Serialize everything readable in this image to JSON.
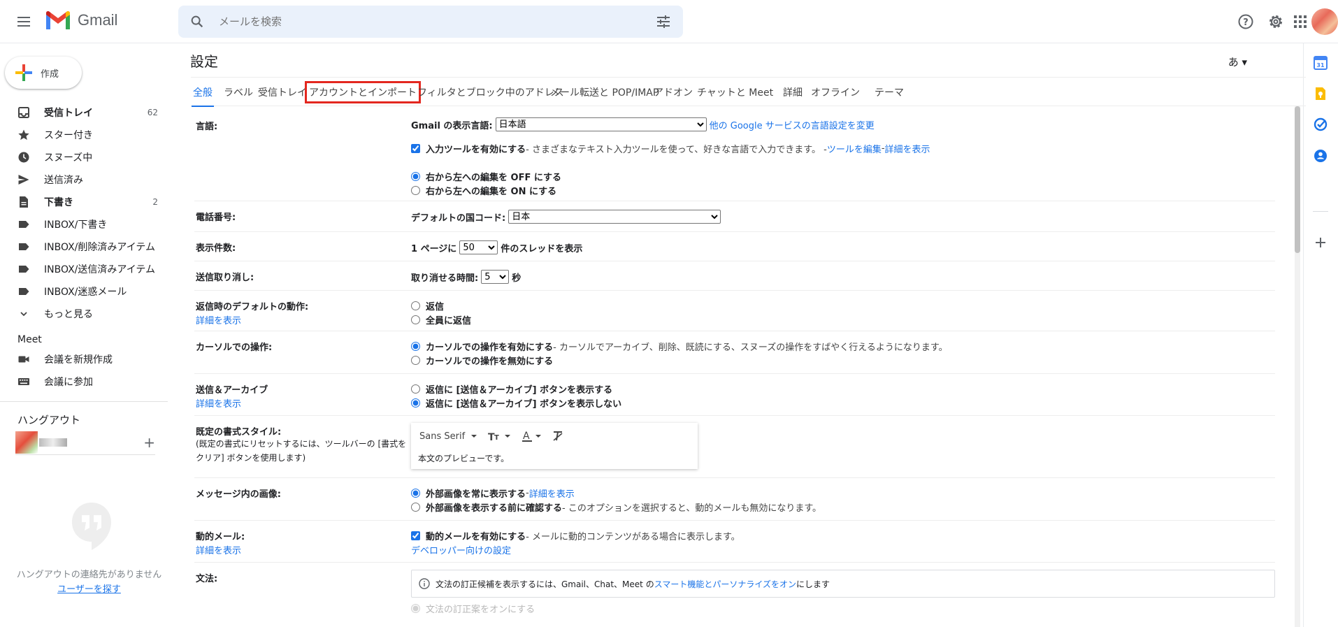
{
  "app": {
    "name": "Gmail"
  },
  "search": {
    "placeholder": "メールを検索"
  },
  "compose": {
    "label": "作成"
  },
  "nav": {
    "items": [
      {
        "label": "受信トレイ",
        "count": "62"
      },
      {
        "label": "スター付き",
        "count": ""
      },
      {
        "label": "スヌーズ中",
        "count": ""
      },
      {
        "label": "送信済み",
        "count": ""
      },
      {
        "label": "下書き",
        "count": "2"
      },
      {
        "label": "INBOX/下書き",
        "count": ""
      },
      {
        "label": "INBOX/削除済みアイテム",
        "count": ""
      },
      {
        "label": "INBOX/送信済みアイテム",
        "count": ""
      },
      {
        "label": "INBOX/迷惑メール",
        "count": ""
      },
      {
        "label": "もっと見る",
        "count": ""
      }
    ]
  },
  "meet": {
    "title": "Meet",
    "new_meeting": "会議を新規作成",
    "join": "会議に参加"
  },
  "hangouts": {
    "title": "ハングアウト",
    "add": "+",
    "empty": "ハングアウトの連絡先がありません",
    "find": "ユーザーを探す"
  },
  "settings": {
    "title": "設定",
    "lang_toggle": "あ ▾",
    "tabs": [
      "全般",
      "ラベル",
      "受信トレイ",
      "アカウントとインポート",
      "フィルタとブロック中のアドレス",
      "メール転送と POP/IMAP",
      "アドオン",
      "チャットと Meet",
      "詳細",
      "オフライン",
      "テーマ"
    ],
    "language": {
      "label": "言語:",
      "display_label": "Gmail の表示言語:",
      "display_value": "日本語",
      "other_link": "他の Google サービスの言語設定を変更",
      "input_tools_bold": "入力ツールを有効にする",
      "input_tools_desc": " - さまざまなテキスト入力ツールを使って、好きな言語で入力できます。 - ",
      "edit_tools": "ツールを編集",
      "sep": " - ",
      "details": "詳細を表示",
      "rtl_off": "右から左への編集を OFF にする",
      "rtl_on": "右から左への編集を ON にする"
    },
    "phone": {
      "label": "電話番号:",
      "country_label": "デフォルトの国コード:",
      "country_value": "日本"
    },
    "page_size": {
      "label": "表示件数:",
      "prefix": "1 ページに",
      "value": "50",
      "suffix": "件のスレッドを表示"
    },
    "undo": {
      "label": "送信取り消し:",
      "prefix": "取り消せる時間:",
      "value": "5",
      "suffix": "秒"
    },
    "reply": {
      "label": "返信時のデフォルトの動作:",
      "details": "詳細を表示",
      "reply": "返信",
      "reply_all": "全員に返信"
    },
    "hover": {
      "label": "カーソルでの操作:",
      "enable": "カーソルでの操作を有効にする",
      "enable_desc": " - カーソルでアーカイブ、削除、既読にする、スヌーズの操作をすばやく行えるようになります。",
      "disable": "カーソルでの操作を無効にする"
    },
    "send_archive": {
      "label": "送信＆アーカイブ",
      "details": "詳細を表示",
      "show": "返信に [送信＆アーカイブ] ボタンを表示する",
      "hide": "返信に [送信＆アーカイブ] ボタンを表示しない"
    },
    "text_style": {
      "label": "既定の書式スタイル:",
      "note_line1": "(既定の書式にリセットするには、ツールバーの [書式を",
      "note_line2": "クリア] ボタンを使用します)",
      "font": "Sans Serif",
      "preview": "本文のプレビューです。"
    },
    "images": {
      "label": "メッセージ内の画像:",
      "always": "外部画像を常に表示する",
      "always_sep": " - ",
      "details": "詳細を表示",
      "ask": "外部画像を表示する前に確認する",
      "ask_desc": " - このオプションを選択すると、動的メールも無効になります。"
    },
    "dynamic": {
      "label": "動的メール:",
      "details": "詳細を表示",
      "enable": "動的メールを有効にする",
      "enable_desc": " - メールに動的コンテンツがある場合に表示します。",
      "dev_link": "デベロッパー向けの設定"
    },
    "grammar": {
      "label": "文法:",
      "info_prefix": "文法の訂正候補を表示するには、Gmail、Chat、Meet の",
      "info_link": "スマート機能とパーソナライズをオン",
      "info_suffix": "にします",
      "option": "文法の訂正案をオンにする"
    }
  }
}
